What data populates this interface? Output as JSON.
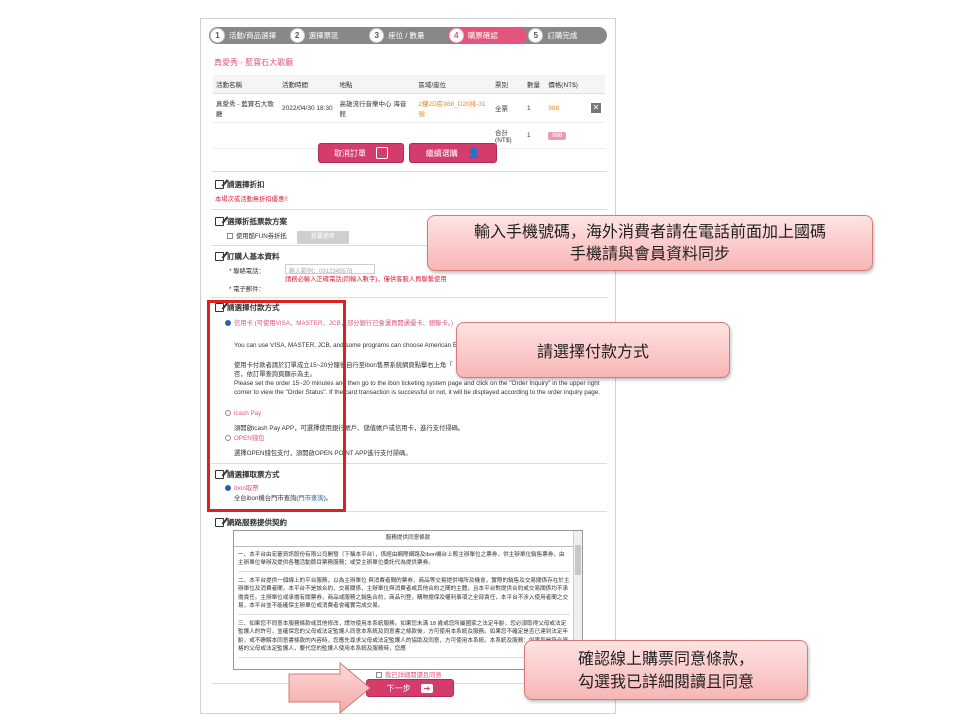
{
  "steps": [
    {
      "num": "1",
      "label": "活動/商品選擇"
    },
    {
      "num": "2",
      "label": "選擇票區"
    },
    {
      "num": "3",
      "label": "座位 / 數量"
    },
    {
      "num": "4",
      "label": "購票確認"
    },
    {
      "num": "5",
      "label": "訂購完成"
    }
  ],
  "active_step": "4",
  "event_title": "真愛秀 - 藍寶石大歌廳",
  "table": {
    "headers": [
      "活動名稱",
      "活動時間",
      "地點",
      "區域/座位",
      "票別",
      "數量",
      "價格(NT$)"
    ],
    "row": {
      "name": "真愛秀 - 藍寶石大歌廳",
      "time": "2022/04/30 18:30",
      "venue": "高雄流行音樂中心 海音館",
      "seat": "2樓2D區988_D20排-31號",
      "type": "全票",
      "qty": "1",
      "price": "988"
    },
    "total_label": "合計(NT$)",
    "total_qty": "1",
    "total_price": "988"
  },
  "buttons": {
    "cancel": "取消訂單",
    "continue": "繼續選購",
    "next": "下一步",
    "coupon": "我要使用"
  },
  "sections": {
    "discount": "請選擇折扣",
    "discount_note": "本場次或活動無折扣優惠!!",
    "offset": "選擇折抵票款方案",
    "offset_option": "使用酷FUN券折抵",
    "buyer": "訂購人基本資料",
    "phone_label": "* 聯絡電話：",
    "phone_placeholder": "輸入範例：0912345678",
    "phone_warning": "請務必輸入正確電話(同輸入數字)，僅供客服人員聯繫使用",
    "email_label": "* 電子郵件：",
    "payment": "請選擇付款方式",
    "pay_credit": "信用卡 (可使用VISA、MASTER、JCB，部分銀行已會運員開通優卡、銀聯卡。)",
    "pay_credit_desc1": "You can use VISA, MASTER, JCB, and some programs can choose American E",
    "pay_credit_desc2": "使用卡付款者請於訂單成立15~20分鐘後自行至ibon售票系統網頁點擊右上角「",
    "pay_credit_desc3": "否，依訂單查詢頁顯示為主。",
    "pay_credit_desc4": "Please set the order 15~20 minutes and then go to the ibon ticketing system page and click on the \"Order Inquiry\" in the upper right corner to view the \"Order Status\". If the card transaction is successful or not, it will be displayed according to the order inquiry page.",
    "pay_icash": "icash Pay",
    "pay_icash_desc": "須開啟icash Pay APP，可選擇使用銀行帳戶、儲值帳戶或信用卡，進行支付掃碼。",
    "pay_open": "OPEN錢包",
    "pay_open_desc": "選擇OPEN錢包支付，須開啟OPEN POINT APP進行支付掃碼。",
    "pickup": "請選擇取票方式",
    "pickup_option": "ibon取票",
    "pickup_desc": "全台ibon機台門市查詢(",
    "pickup_link": "門市查詢",
    "pickup_end": ")。",
    "contract": "網路服務提供契約",
    "agree": "我已詳細閱讀且同意"
  },
  "terms": {
    "title": "服務提供同意條款",
    "p1": "一、本平台由宏碁資訊股份有限公司開發（下稱本平台），係經由網際網路及ibon機台上販主辦單位之票券，供主辦單位銷售票券，由主辦單位舉辦及提供各種活動節目票務服務；或受主辦單位委託代為提供票券。",
    "p2": "二、本平台提供一個線上的平台服務，以為主辦單位 與消費者間的票券，商品等交易提供場所及機會，實際的銷售及交易關係存在於主辦單位及消費者間，本平台不是該合約、交易關係，主辦單位與消費者或其他合約之間的主體，且本平台對提供合約或交易關係均不承擔責任。主辦單位或承擔有關票券，商品或服務之銷售合約，商品刊登，購物擔保及權利事項之全部責任，本平台不涉入使用者間之交易，本平台並不能確保主辦單位或消費者會確實完成交易。",
    "p3": "三、如果您不同意本服務條款或其他修改，請勿使用本系統服務。如果您未滿 18 歲或您所屬國家之法定年齡，您必須取得父母或法定監護人的許可，並確保您的父母或法定監護人同意本系統及同意書之條款後，方可使用本系統及服務。如果您不確定是否已達到法定年齡，或不瞭解本同意書條款的內容時，您應先尋求父母或法定監護人的協助及同意，方可使用本系統。本系統及服務：如果您是符合資格的父母或法定監護人，要代您的監護人使用本系統及服務時，您應"
  },
  "callouts": {
    "phone_line1": "輸入手機號碼，海外消費者請在電話前面加上國碼",
    "phone_line2": "手機請與會員資料同步",
    "payment": "請選擇付款方式",
    "confirm_line1": "確認線上購票同意條款，",
    "confirm_line2": "勾選我已詳細閱讀且同意"
  },
  "colors": {
    "accent": "#e3557c",
    "button": "#d43c6c",
    "warning": "#e0203c",
    "highlight_box": "#e02020"
  }
}
